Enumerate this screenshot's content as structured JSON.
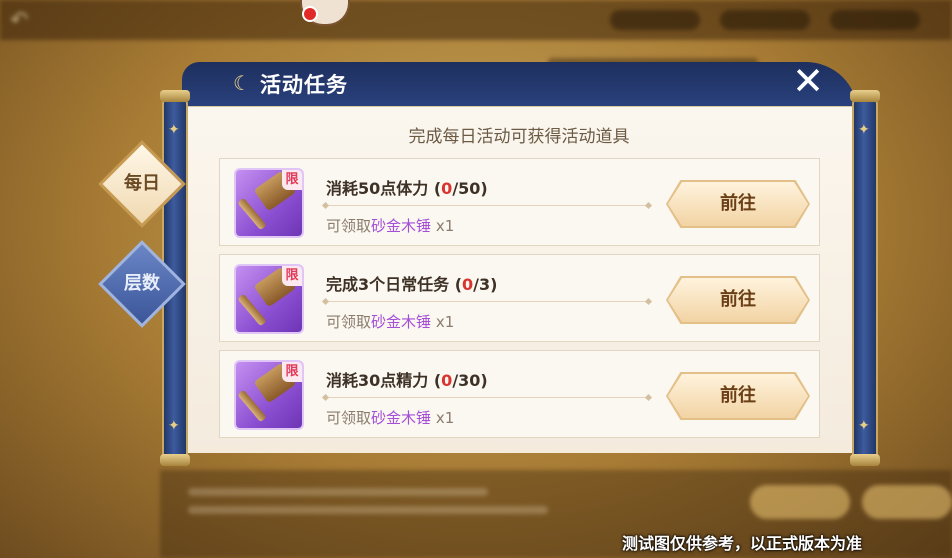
{
  "panel": {
    "title": "活动任务",
    "subtitle": "完成每日活动可获得活动道具"
  },
  "tabs": [
    {
      "label": "每日",
      "active": true
    },
    {
      "label": "层数",
      "active": false
    }
  ],
  "tasks": [
    {
      "name": "消耗50点体力",
      "progress_current": "0",
      "progress_total": "50",
      "reward_prefix": "可领取",
      "reward_item": "砂金木锤",
      "reward_qty": "x1",
      "limit_tag": "限",
      "button": "前往"
    },
    {
      "name": "完成3个日常任务",
      "progress_current": "0",
      "progress_total": "3",
      "reward_prefix": "可领取",
      "reward_item": "砂金木锤",
      "reward_qty": "x1",
      "limit_tag": "限",
      "button": "前往"
    },
    {
      "name": "消耗30点精力",
      "progress_current": "0",
      "progress_total": "30",
      "reward_prefix": "可领取",
      "reward_item": "砂金木锤",
      "reward_qty": "x1",
      "limit_tag": "限",
      "button": "前往"
    }
  ],
  "disclaimer": "测试图仅供参考，以正式版本为准",
  "icons": {
    "title": "crescent-icon",
    "close": "close-icon",
    "item": "hammer-icon"
  },
  "colors": {
    "header": "#2b4482",
    "progress_current": "#d8352f",
    "reward_item": "#a44fd6",
    "button": "#f2d4a4"
  }
}
